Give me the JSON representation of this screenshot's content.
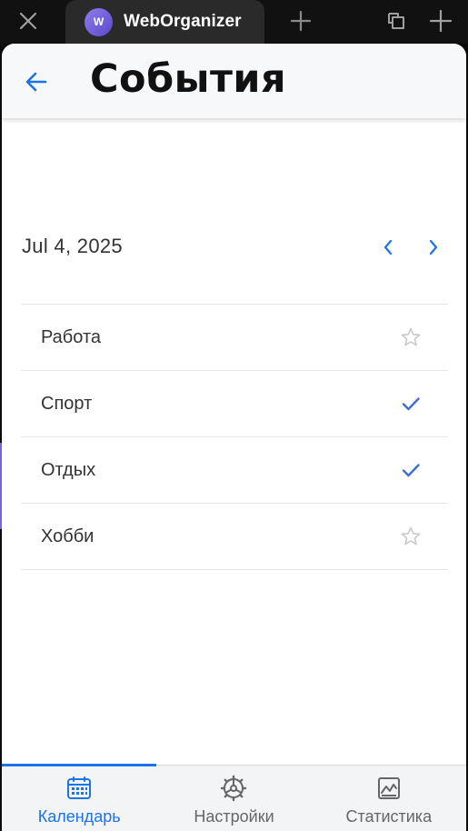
{
  "browser": {
    "tab_title": "WebOrganizer",
    "favicon_letter": "W"
  },
  "header": {
    "title": "События"
  },
  "date_nav": {
    "date": "Jul 4, 2025",
    "prev_glyph": "‹",
    "next_glyph": "›"
  },
  "events": [
    {
      "label": "Работа",
      "mark": "star-outline-icon"
    },
    {
      "label": "Спорт",
      "mark": "check-icon"
    },
    {
      "label": "Отдых",
      "mark": "check-icon"
    },
    {
      "label": "Хобби",
      "mark": "star-outline-icon"
    }
  ],
  "bottom_nav": {
    "tabs": [
      {
        "label": "Календарь",
        "icon": "calendar-icon",
        "active": true
      },
      {
        "label": "Настройки",
        "icon": "settings-icon",
        "active": false
      },
      {
        "label": "Статистика",
        "icon": "chart-icon",
        "active": false
      }
    ]
  },
  "colors": {
    "accent": "#1a73e8",
    "check": "#3d6fd0",
    "star": "#c9c9c9",
    "favicon": "#7b68e0"
  }
}
